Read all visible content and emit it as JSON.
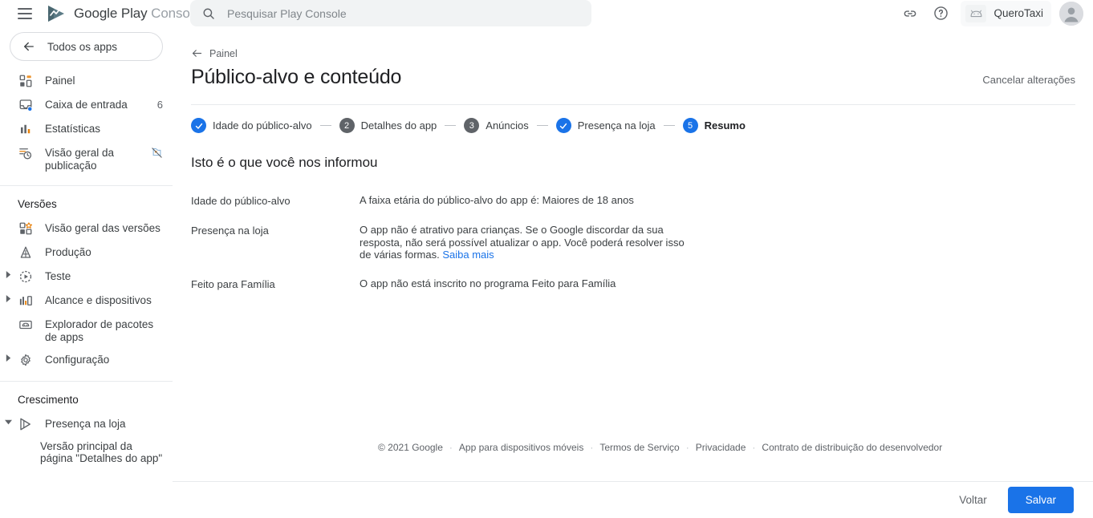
{
  "colors": {
    "accent": "#1a73e8",
    "accent_dark": "#1967d2",
    "step_inactive": "#5f6368",
    "text_primary": "#202124",
    "text_secondary": "#5f6368",
    "logo": "#5c7b86"
  },
  "topbar": {
    "menu_label": "Menu",
    "brand_bold": "Google Play",
    "brand_light": "Console",
    "search": {
      "placeholder": "Pesquisar Play Console",
      "value": ""
    },
    "link_icon_title": "Links",
    "help_icon_title": "Ajuda",
    "app_chip": {
      "name": "QueroTaxi"
    },
    "account_title": "Conta do Google"
  },
  "sidebar": {
    "all_apps_label": "Todos os apps",
    "main_items": [
      {
        "label": "Painel",
        "icon": "dashboard-icon",
        "badge": "",
        "trailing": ""
      },
      {
        "label": "Caixa de entrada",
        "icon": "inbox-icon",
        "badge": "6",
        "trailing": ""
      },
      {
        "label": "Estatísticas",
        "icon": "bar-chart-icon",
        "badge": "",
        "trailing": ""
      },
      {
        "label": "Visão geral da publicação",
        "icon": "publishing-overview-icon",
        "badge": "",
        "trailing": "muted-icon"
      }
    ],
    "groups": [
      {
        "title": "Versões",
        "items": [
          {
            "label": "Visão geral das versões",
            "icon": "releases-overview-icon",
            "expandable": false
          },
          {
            "label": "Produção",
            "icon": "production-icon",
            "expandable": false
          },
          {
            "label": "Teste",
            "icon": "testing-icon",
            "expandable": true
          },
          {
            "label": "Alcance e dispositivos",
            "icon": "reach-devices-icon",
            "expandable": true
          },
          {
            "label": "Explorador de pacotes de apps",
            "icon": "app-bundle-explorer-icon",
            "expandable": false
          },
          {
            "label": "Configuração",
            "icon": "gear-icon",
            "expandable": true
          }
        ]
      },
      {
        "title": "Crescimento",
        "items": [
          {
            "label": "Presença na loja",
            "icon": "store-presence-icon",
            "expandable": true,
            "expanded": true
          }
        ],
        "subitems": [
          {
            "label": "Versão principal da página \"Detalhes do app\""
          }
        ]
      }
    ]
  },
  "main": {
    "breadcrumb": "Painel",
    "page_title": "Público-alvo e conteúdo",
    "cancel_label": "Cancelar alterações",
    "steps": [
      {
        "num": "1",
        "label": "Idade do público-alvo",
        "state": "done"
      },
      {
        "num": "2",
        "label": "Detalhes do app",
        "state": "pending"
      },
      {
        "num": "3",
        "label": "Anúncios",
        "state": "pending"
      },
      {
        "num": "4",
        "label": "Presença na loja",
        "state": "done"
      },
      {
        "num": "5",
        "label": "Resumo",
        "state": "current"
      }
    ],
    "section_title": "Isto é o que você nos informou",
    "summary": [
      {
        "label": "Idade do público-alvo",
        "value": "A faixa etária do público-alvo do app é: Maiores de 18 anos",
        "link": ""
      },
      {
        "label": "Presença na loja",
        "value": "O app não é atrativo para crianças. Se o Google discordar da sua resposta, não será possível atualizar o app. Você poderá resolver isso de várias formas.",
        "link": "Saiba mais"
      },
      {
        "label": "Feito para Família",
        "value": "O app não está inscrito no programa Feito para Família",
        "link": ""
      }
    ],
    "footer": {
      "copyright": "© 2021 Google",
      "links": [
        "App para dispositivos móveis",
        "Termos de Serviço",
        "Privacidade",
        "Contrato de distribuição do desenvolvedor"
      ]
    },
    "actions": {
      "back_label": "Voltar",
      "save_label": "Salvar"
    }
  }
}
